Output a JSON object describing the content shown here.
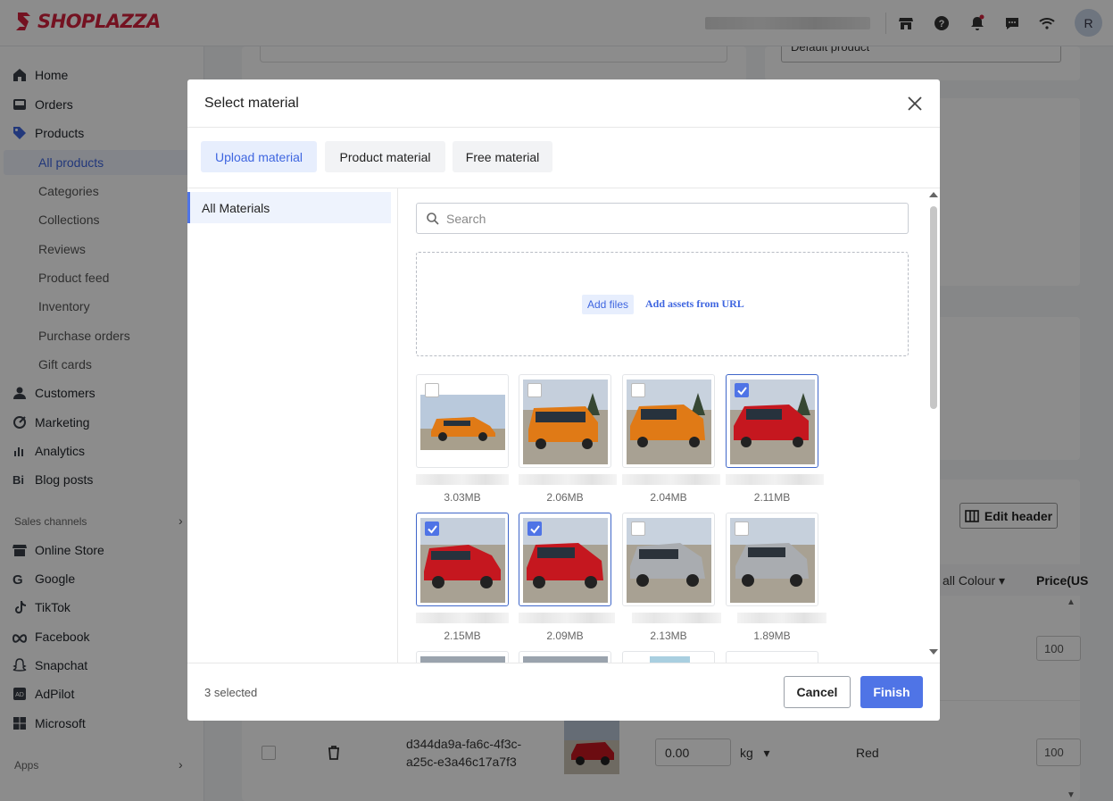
{
  "brand": {
    "name": "SHOPLAZZA",
    "color": "#d4213d"
  },
  "topbar": {
    "icons": [
      "store-icon",
      "help-icon",
      "bell-icon",
      "chat-icon",
      "wifi-icon"
    ],
    "avatar_initial": "R"
  },
  "sidebar": {
    "items": [
      {
        "label": "Home",
        "icon": "home-icon"
      },
      {
        "label": "Orders",
        "icon": "inbox-icon"
      },
      {
        "label": "Products",
        "icon": "tag-icon"
      },
      {
        "label": "All products",
        "sub": true,
        "active": true
      },
      {
        "label": "Categories",
        "sub": true
      },
      {
        "label": "Collections",
        "sub": true
      },
      {
        "label": "Reviews",
        "sub": true
      },
      {
        "label": "Product feed",
        "sub": true
      },
      {
        "label": "Inventory",
        "sub": true
      },
      {
        "label": "Purchase orders",
        "sub": true
      },
      {
        "label": "Gift cards",
        "sub": true
      },
      {
        "label": "Customers",
        "icon": "person-icon"
      },
      {
        "label": "Marketing",
        "icon": "megaphone-icon"
      },
      {
        "label": "Analytics",
        "icon": "bar-chart-icon"
      },
      {
        "label": "Blog posts",
        "icon": "blog-icon"
      }
    ],
    "sales_channels_label": "Sales channels",
    "channels": [
      {
        "label": "Online Store",
        "icon": "store-icon"
      },
      {
        "label": "Google",
        "icon": "google-icon"
      },
      {
        "label": "TikTok",
        "icon": "tiktok-icon"
      },
      {
        "label": "Facebook",
        "icon": "meta-icon"
      },
      {
        "label": "Snapchat",
        "icon": "ghost-icon"
      },
      {
        "label": "AdPilot",
        "icon": "adpilot-icon"
      },
      {
        "label": "Microsoft",
        "icon": "windows-icon"
      }
    ],
    "apps_label": "Apps"
  },
  "background": {
    "default_product_select": "Default product",
    "edit_header_label": "Edit header",
    "colour_header": "all Colour",
    "price_header": "Price(US",
    "row": {
      "id": "d344da9a-fa6c-4f3c-a25c-e3a46c17a7f3",
      "weight": "0.00",
      "unit": "kg",
      "colour": "Red",
      "price": "100"
    },
    "price_above": "100"
  },
  "modal": {
    "title": "Select material",
    "tabs": [
      {
        "label": "Upload material",
        "active": true
      },
      {
        "label": "Product material",
        "active": false
      },
      {
        "label": "Free material",
        "active": false
      }
    ],
    "folder": "All Materials",
    "search_placeholder": "Search",
    "add_files_label": "Add files",
    "add_url_label": "Add assets from URL",
    "materials": [
      {
        "size": "3.03MB",
        "color": "orange",
        "selected": false
      },
      {
        "size": "2.06MB",
        "color": "orange",
        "selected": false
      },
      {
        "size": "2.04MB",
        "color": "orange",
        "selected": false
      },
      {
        "size": "2.11MB",
        "color": "red",
        "selected": true
      },
      {
        "size": "2.15MB",
        "color": "red",
        "selected": true
      },
      {
        "size": "2.09MB",
        "color": "red",
        "selected": true
      },
      {
        "size": "2.13MB",
        "color": "silver",
        "selected": false
      },
      {
        "size": "1.89MB",
        "color": "silver",
        "selected": false
      }
    ],
    "selected_count": "3 selected",
    "cancel_label": "Cancel",
    "finish_label": "Finish"
  },
  "colors": {
    "accent": "#4f74e6",
    "accent_text": "#3f66e0",
    "overlay": "rgba(0,0,0,0.45)"
  }
}
